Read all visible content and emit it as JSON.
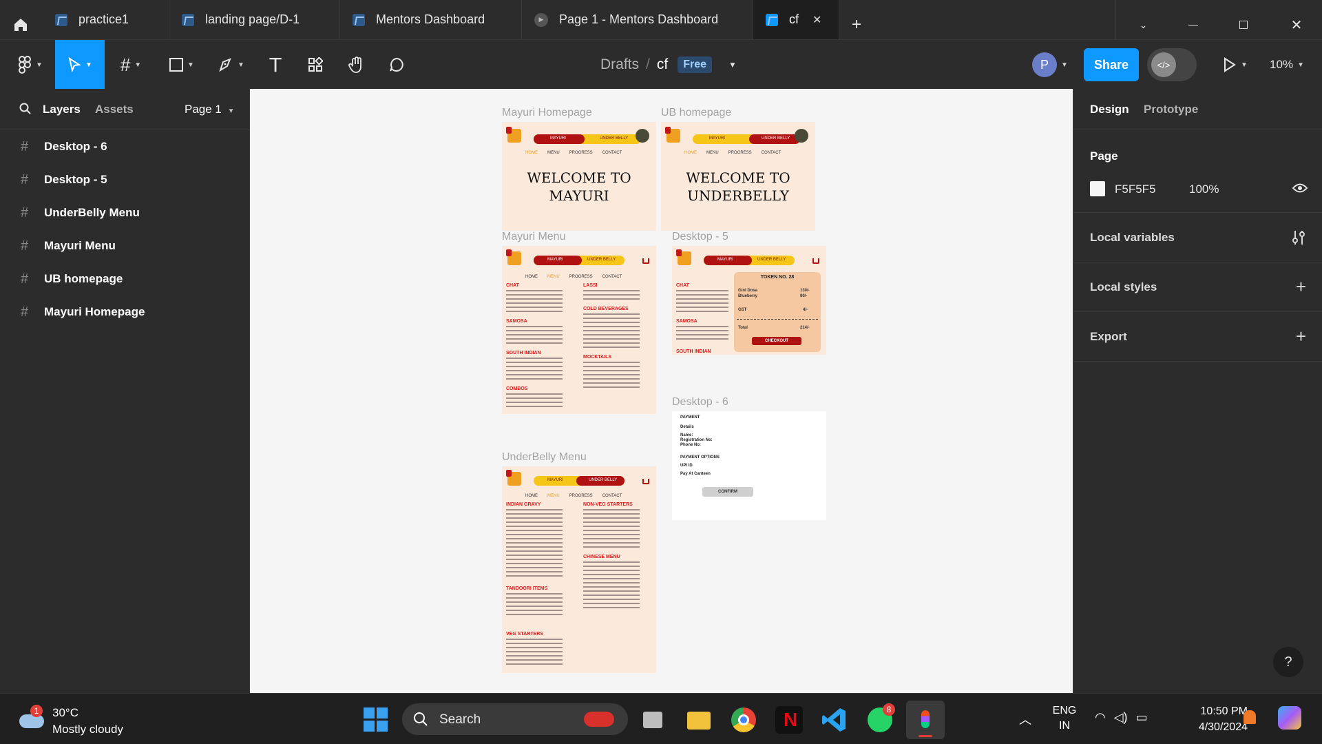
{
  "tabs": {
    "items": [
      {
        "label": "practice1"
      },
      {
        "label": "landing page/D-1"
      },
      {
        "label": "Mentors Dashboard"
      },
      {
        "label": "Page 1 - Mentors Dashboard"
      },
      {
        "label": "cf"
      }
    ],
    "new_tab": "+",
    "close": "✕"
  },
  "toolbar": {
    "breadcrumb_root": "Drafts",
    "separator": "/",
    "file_name": "cf",
    "plan_badge": "Free",
    "avatar_initial": "P",
    "share_label": "Share",
    "zoom": "10%"
  },
  "left_panel": {
    "tab_layers": "Layers",
    "tab_assets": "Assets",
    "page_selector": "Page 1",
    "layers": [
      "Desktop - 6",
      "Desktop - 5",
      "UnderBelly Menu",
      "Mayuri Menu",
      "UB homepage",
      "Mayuri Homepage"
    ]
  },
  "canvas": {
    "frame_labels": {
      "mayuri_homepage": "Mayuri Homepage",
      "ub_homepage": "UB homepage",
      "mayuri_menu": "Mayuri Menu",
      "desktop5": "Desktop - 5",
      "desktop6": "Desktop - 6",
      "underbelly_menu": "UnderBelly Menu"
    },
    "nav": {
      "mayuri": "MAYURI",
      "under_belly": "UNDER BELLY",
      "home": "HOME",
      "menu": "MENU",
      "progress": "PROGRESS",
      "contact": "CONTACT"
    },
    "welcome_mayuri_1": "WELCOME TO",
    "welcome_mayuri_2": "MAYURI",
    "welcome_ub_1": "WELCOME TO",
    "welcome_ub_2": "UNDERBELLY",
    "mayuri_menu_sections": {
      "chat": "CHAT",
      "lassi": "LASSI",
      "cold_beverages": "COLD BEVERAGES",
      "samosa": "SAMOSA",
      "south_indian": "SOUTH INDIAN",
      "mocktails": "MOCKTAILS",
      "combos": "COMBOS"
    },
    "desktop5": {
      "token": "TOKEN NO. 28",
      "item1": "Gini Dosa",
      "price1": "130/-",
      "item2": "Blueberry",
      "price2": "80/-",
      "gst": "GST",
      "gst_value": "4/-",
      "total": "Total",
      "total_value": "214/-",
      "checkout": "CHECKOUT",
      "chat": "CHAT",
      "samosa": "SAMOSA",
      "south_indian": "SOUTH INDIAN"
    },
    "desktop6": {
      "payment": "PAYMENT",
      "details": "Details",
      "name": "Name:",
      "registration": "Registration No:",
      "phone": "Phone No:",
      "payment_options": "PAYMENT OPTIONS",
      "upi": "UPI ID",
      "canteen": "Pay At Canteen",
      "confirm": "CONFIRM"
    },
    "ub_menu_sections": {
      "indian_gravy": "INDIAN GRAVY",
      "non_veg_starters": "NON-VEG STARTERS",
      "chinese_menu": "CHINESE MENU",
      "tandoori_items": "TANDOORI ITEMS",
      "veg_starters": "VEG STARTERS"
    }
  },
  "right_panel": {
    "tab_design": "Design",
    "tab_prototype": "Prototype",
    "page_heading": "Page",
    "page_color": "F5F5F5",
    "page_opacity": "100%",
    "local_variables": "Local variables",
    "local_styles": "Local styles",
    "export": "Export",
    "help": "?"
  },
  "taskbar": {
    "weather_temp": "30°C",
    "weather_desc": "Mostly cloudy",
    "weather_badge": "1",
    "search_label": "Search",
    "whatsapp_badge": "8",
    "lang_1": "ENG",
    "lang_2": "IN",
    "time": "10:50 PM",
    "date": "4/30/2024"
  },
  "colors": {
    "accent": "#0d99ff",
    "share": "#0d99ff",
    "nav_red": "#b01111",
    "nav_yellow": "#f5c518",
    "frame_bg": "#fbe9dc"
  }
}
